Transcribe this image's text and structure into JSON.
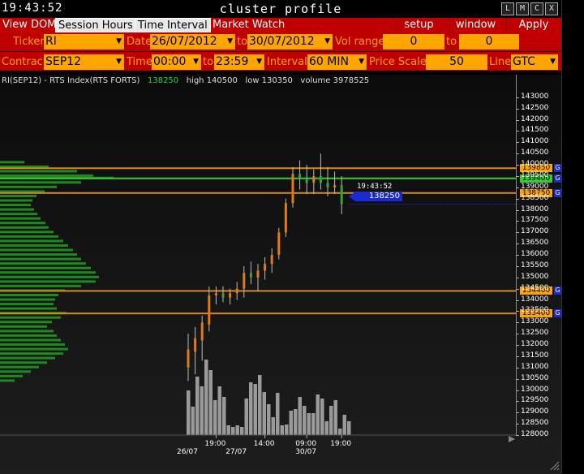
{
  "window": {
    "clock": "19:43:52",
    "title": "cluster profile",
    "buttons": [
      "L",
      "M",
      "C",
      "X"
    ]
  },
  "menu": {
    "left": [
      "View DOM",
      "Session Hours",
      "Time Interval",
      "Market Watch"
    ],
    "right": [
      "setup",
      "window",
      "Apply"
    ],
    "selected": [
      "Session Hours",
      "Time Interval"
    ]
  },
  "controls": {
    "ticker_label": "Ticker",
    "ticker_value": "RI",
    "date_label": "Date",
    "date_from": "26/07/2012",
    "to_label": "to",
    "date_to": "30/07/2012",
    "vol_range_label": "Vol range",
    "vol_from": "0",
    "vol_to_label": "to",
    "vol_to": "0",
    "contract_label": "Contract",
    "contract_value": "SEP12",
    "time_label": "Time",
    "time_from": "00:00",
    "time_to_label": "to",
    "time_to": "23:59",
    "interval_label": "Interval",
    "interval_value": "60 MIN",
    "price_scale_label": "Price Scale",
    "price_scale_value": "50",
    "line_label": "Line",
    "line_value": "GTC"
  },
  "chart_header": {
    "symbol": "RI(SEP12) - RTS Index(RTS FORTS)",
    "last": "138250",
    "high": "high 140500",
    "low": "low 130350",
    "volume": "volume 3978525"
  },
  "colors": {
    "menu_red": "#c00000",
    "field_orange": "#ffa500",
    "level_orange": "#d98a1a",
    "level_green": "#33cc33",
    "tag_blue": "#1c2bd0",
    "profile_green": "#1e8a1e"
  },
  "cursor": {
    "time": "19:43:52",
    "price": "138250"
  },
  "chart_data": {
    "type": "candlestick",
    "y_range": [
      128000,
      143500
    ],
    "y_ticks": [
      143000,
      142500,
      142000,
      141500,
      141000,
      140500,
      140000,
      139500,
      139000,
      138500,
      138000,
      137500,
      137000,
      136500,
      136000,
      135500,
      135000,
      134500,
      134000,
      133500,
      133000,
      132500,
      132000,
      131500,
      131000,
      130500,
      130000,
      129500,
      129000,
      128500,
      128000
    ],
    "x_ticks": [
      {
        "label": "26/07",
        "bar": 0,
        "row": 2
      },
      {
        "label": "19:00",
        "bar": 4,
        "row": 1
      },
      {
        "label": "27/07",
        "bar": 7,
        "row": 2
      },
      {
        "label": "14:00",
        "bar": 11,
        "row": 1
      },
      {
        "label": "09:00",
        "bar": 17,
        "row": 1
      },
      {
        "label": "30/07",
        "bar": 17,
        "row": 2
      },
      {
        "label": "19:00",
        "bar": 22,
        "row": 1
      }
    ],
    "levels": [
      {
        "price": 139850,
        "label": "139850",
        "color": "orange",
        "tag": "G"
      },
      {
        "price": 139400,
        "label": "139400",
        "color": "green",
        "tag": "G"
      },
      {
        "price": 138750,
        "label": "138750",
        "color": "orange",
        "tag": "G"
      },
      {
        "price": 134400,
        "label": "134400",
        "color": "orange",
        "tag": "G"
      },
      {
        "price": 133400,
        "label": "133400",
        "color": "orange",
        "tag": "G"
      }
    ],
    "bars": [
      {
        "o": 131000,
        "h": 132500,
        "l": 130400,
        "c": 131800
      },
      {
        "o": 131700,
        "h": 132800,
        "l": 130700,
        "c": 132300
      },
      {
        "o": 132200,
        "h": 133300,
        "l": 131300,
        "c": 133000
      },
      {
        "o": 132900,
        "h": 134600,
        "l": 132600,
        "c": 134200
      },
      {
        "o": 134200,
        "h": 134600,
        "l": 133800,
        "c": 134300
      },
      {
        "o": 134300,
        "h": 134600,
        "l": 133900,
        "c": 134100
      },
      {
        "o": 134100,
        "h": 134500,
        "l": 133800,
        "c": 134300
      },
      {
        "o": 134300,
        "h": 134800,
        "l": 134000,
        "c": 134500
      },
      {
        "o": 134500,
        "h": 135500,
        "l": 134100,
        "c": 135200
      },
      {
        "o": 135200,
        "h": 135700,
        "l": 134700,
        "c": 135000
      },
      {
        "o": 135000,
        "h": 135600,
        "l": 134400,
        "c": 135300
      },
      {
        "o": 135300,
        "h": 135900,
        "l": 134900,
        "c": 135600
      },
      {
        "o": 135600,
        "h": 136300,
        "l": 135200,
        "c": 136000
      },
      {
        "o": 136000,
        "h": 137200,
        "l": 135800,
        "c": 137000
      },
      {
        "o": 137000,
        "h": 138500,
        "l": 136800,
        "c": 138300
      },
      {
        "o": 138300,
        "h": 139900,
        "l": 138100,
        "c": 139600
      },
      {
        "o": 139600,
        "h": 140200,
        "l": 138900,
        "c": 139400
      },
      {
        "o": 139400,
        "h": 140000,
        "l": 138700,
        "c": 139200
      },
      {
        "o": 139200,
        "h": 139800,
        "l": 138700,
        "c": 139500
      },
      {
        "o": 139500,
        "h": 140500,
        "l": 138900,
        "c": 139200
      },
      {
        "o": 139200,
        "h": 139900,
        "l": 138600,
        "c": 139000
      },
      {
        "o": 139000,
        "h": 139700,
        "l": 138700,
        "c": 139100
      },
      {
        "o": 139100,
        "h": 139500,
        "l": 137800,
        "c": 138250
      }
    ],
    "volumes": [
      0.55,
      0.35,
      0.72,
      0.6,
      0.93,
      0.8,
      0.43,
      0.6,
      0.47,
      0.12,
      0.1,
      0.12,
      0.1,
      0.45,
      0.65,
      0.63,
      0.74,
      0.53,
      0.38,
      0.22,
      0.52,
      0.12,
      0.13,
      0.3,
      0.32,
      0.47,
      0.36,
      0.27,
      0.27,
      0.5,
      0.45,
      0.17,
      0.36,
      0.43,
      0.08,
      0.25,
      0.17
    ],
    "profile": [
      {
        "price": 140100,
        "len": 30
      },
      {
        "price": 139900,
        "len": 60
      },
      {
        "price": 139700,
        "len": 95
      },
      {
        "price": 139500,
        "len": 115
      },
      {
        "price": 139400,
        "len": 140
      },
      {
        "price": 139200,
        "len": 100
      },
      {
        "price": 139000,
        "len": 70
      },
      {
        "price": 138800,
        "len": 55
      },
      {
        "price": 138600,
        "len": 45
      },
      {
        "price": 138400,
        "len": 40
      },
      {
        "price": 138200,
        "len": 38
      },
      {
        "price": 138000,
        "len": 42
      },
      {
        "price": 137800,
        "len": 46
      },
      {
        "price": 137600,
        "len": 50
      },
      {
        "price": 137400,
        "len": 56
      },
      {
        "price": 137200,
        "len": 60
      },
      {
        "price": 137000,
        "len": 66
      },
      {
        "price": 136800,
        "len": 72
      },
      {
        "price": 136600,
        "len": 78
      },
      {
        "price": 136400,
        "len": 84
      },
      {
        "price": 136200,
        "len": 90
      },
      {
        "price": 136000,
        "len": 95
      },
      {
        "price": 135800,
        "len": 100
      },
      {
        "price": 135600,
        "len": 106
      },
      {
        "price": 135400,
        "len": 112
      },
      {
        "price": 135200,
        "len": 118
      },
      {
        "price": 135000,
        "len": 122
      },
      {
        "price": 134800,
        "len": 118
      },
      {
        "price": 134600,
        "len": 100
      },
      {
        "price": 134400,
        "len": 80
      },
      {
        "price": 134200,
        "len": 72
      },
      {
        "price": 134000,
        "len": 68
      },
      {
        "price": 133800,
        "len": 66
      },
      {
        "price": 133600,
        "len": 70
      },
      {
        "price": 133400,
        "len": 82
      },
      {
        "price": 133200,
        "len": 75
      },
      {
        "price": 133000,
        "len": 64
      },
      {
        "price": 132800,
        "len": 58
      },
      {
        "price": 132600,
        "len": 66
      },
      {
        "price": 132400,
        "len": 70
      },
      {
        "price": 132200,
        "len": 75
      },
      {
        "price": 132000,
        "len": 80
      },
      {
        "price": 131800,
        "len": 84
      },
      {
        "price": 131600,
        "len": 78
      },
      {
        "price": 131400,
        "len": 68
      },
      {
        "price": 131200,
        "len": 58
      },
      {
        "price": 131000,
        "len": 48
      },
      {
        "price": 130800,
        "len": 38
      },
      {
        "price": 130600,
        "len": 28
      },
      {
        "price": 130400,
        "len": 18
      }
    ]
  }
}
